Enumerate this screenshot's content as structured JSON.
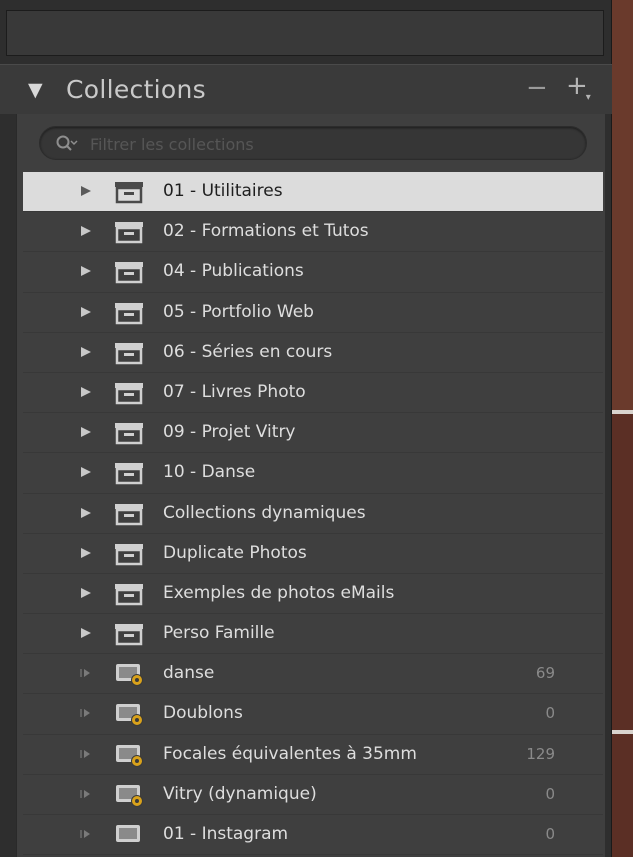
{
  "panel": {
    "title": "Collections",
    "minus_label": "−",
    "plus_label": "+",
    "plus_sub": "▾"
  },
  "search": {
    "placeholder": "Filtrer les collections"
  },
  "colors": {
    "selected_row": "#dcdcdc",
    "row_text": "#dedede",
    "panel_bg": "#3f3f3f",
    "smart_badge": "#d9a21b"
  },
  "collections": [
    {
      "label": "01 - Utilitaires",
      "type": "set",
      "count": "",
      "selected": true
    },
    {
      "label": "02 - Formations et Tutos",
      "type": "set",
      "count": ""
    },
    {
      "label": "04 - Publications",
      "type": "set",
      "count": ""
    },
    {
      "label": "05 - Portfolio Web",
      "type": "set",
      "count": ""
    },
    {
      "label": "06 - Séries en cours",
      "type": "set",
      "count": ""
    },
    {
      "label": "07 - Livres Photo",
      "type": "set",
      "count": ""
    },
    {
      "label": "09 - Projet Vitry",
      "type": "set",
      "count": ""
    },
    {
      "label": "10 - Danse",
      "type": "set",
      "count": ""
    },
    {
      "label": "Collections dynamiques",
      "type": "set",
      "count": ""
    },
    {
      "label": "Duplicate Photos",
      "type": "set",
      "count": ""
    },
    {
      "label": "Exemples de photos eMails",
      "type": "set",
      "count": ""
    },
    {
      "label": "Perso Famille",
      "type": "set",
      "count": ""
    },
    {
      "label": "danse",
      "type": "smart",
      "count": "69"
    },
    {
      "label": "Doublons",
      "type": "smart",
      "count": "0"
    },
    {
      "label": "Focales équivalentes à 35mm",
      "type": "smart",
      "count": "129"
    },
    {
      "label": "Vitry (dynamique)",
      "type": "smart",
      "count": "0"
    },
    {
      "label": "01 - Instagram",
      "type": "collection",
      "count": "0"
    }
  ]
}
